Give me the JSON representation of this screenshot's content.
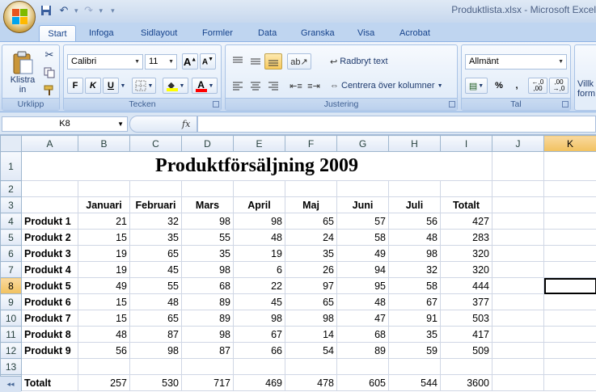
{
  "window": {
    "title": "Produktlista.xlsx - Microsoft Excel"
  },
  "qat": {
    "icons": [
      "save-icon",
      "undo-icon",
      "redo-icon",
      "customize-icon"
    ]
  },
  "tabs": [
    {
      "label": "Start",
      "active": true
    },
    {
      "label": "Infoga"
    },
    {
      "label": "Sidlayout"
    },
    {
      "label": "Formler"
    },
    {
      "label": "Data"
    },
    {
      "label": "Granska"
    },
    {
      "label": "Visa"
    },
    {
      "label": "Acrobat"
    }
  ],
  "ribbon": {
    "clipboard": {
      "paste_label": "Klistra",
      "paste_sub": "in",
      "group_label": "Urklipp"
    },
    "font": {
      "family": "Calibri",
      "size": "11",
      "bold": "F",
      "italic": "K",
      "underline": "U",
      "group_label": "Tecken",
      "grow": "A",
      "shrink": "A",
      "font_color": "A"
    },
    "alignment": {
      "wrap_text": "Radbryt text",
      "merge_center": "Centrera över kolumner",
      "group_label": "Justering"
    },
    "number": {
      "format": "Allmänt",
      "percent": "%",
      "comma": ",",
      "inc_decimal": "←,0 ,00",
      "dec_decimal": ",00 →,0",
      "group_label": "Tal"
    },
    "styles": {
      "partial_label": "Villk",
      "partial_label2": "form"
    }
  },
  "formula_bar": {
    "cell_ref": "K8",
    "fx": "fx",
    "value": ""
  },
  "sheet": {
    "columns": [
      "A",
      "B",
      "C",
      "D",
      "E",
      "F",
      "G",
      "H",
      "I",
      "J",
      "K"
    ],
    "selected_column": "K",
    "selected_row": 8,
    "title": "Produktförsäljning 2009",
    "headers": [
      "Januari",
      "Februari",
      "Mars",
      "April",
      "Maj",
      "Juni",
      "Juli",
      "Totalt"
    ],
    "rows": [
      {
        "name": "Produkt 1",
        "values": [
          "21",
          "32",
          "98",
          "98",
          "65",
          "57",
          "56",
          "427"
        ]
      },
      {
        "name": "Produkt 2",
        "values": [
          "15",
          "35",
          "55",
          "48",
          "24",
          "58",
          "48",
          "283"
        ]
      },
      {
        "name": "Produkt 3",
        "values": [
          "19",
          "65",
          "35",
          "19",
          "35",
          "49",
          "98",
          "320"
        ]
      },
      {
        "name": "Produkt 4",
        "values": [
          "19",
          "45",
          "98",
          "6",
          "26",
          "94",
          "32",
          "320"
        ]
      },
      {
        "name": "Produkt 5",
        "values": [
          "49",
          "55",
          "68",
          "22",
          "97",
          "95",
          "58",
          "444"
        ]
      },
      {
        "name": "Produkt 6",
        "values": [
          "15",
          "48",
          "89",
          "45",
          "65",
          "48",
          "67",
          "377"
        ]
      },
      {
        "name": "Produkt 7",
        "values": [
          "15",
          "65",
          "89",
          "98",
          "98",
          "47",
          "91",
          "503"
        ]
      },
      {
        "name": "Produkt 8",
        "values": [
          "48",
          "87",
          "98",
          "67",
          "14",
          "68",
          "35",
          "417"
        ]
      },
      {
        "name": "Produkt 9",
        "values": [
          "56",
          "98",
          "87",
          "66",
          "54",
          "89",
          "59",
          "509"
        ]
      }
    ],
    "total": {
      "name": "Totalt",
      "values": [
        "257",
        "530",
        "717",
        "469",
        "478",
        "605",
        "544",
        "3600"
      ]
    }
  },
  "colors": {
    "accent": "#15428b",
    "selected_header": "#f1c15f",
    "ribbon_bg": "#dbe7f6"
  }
}
